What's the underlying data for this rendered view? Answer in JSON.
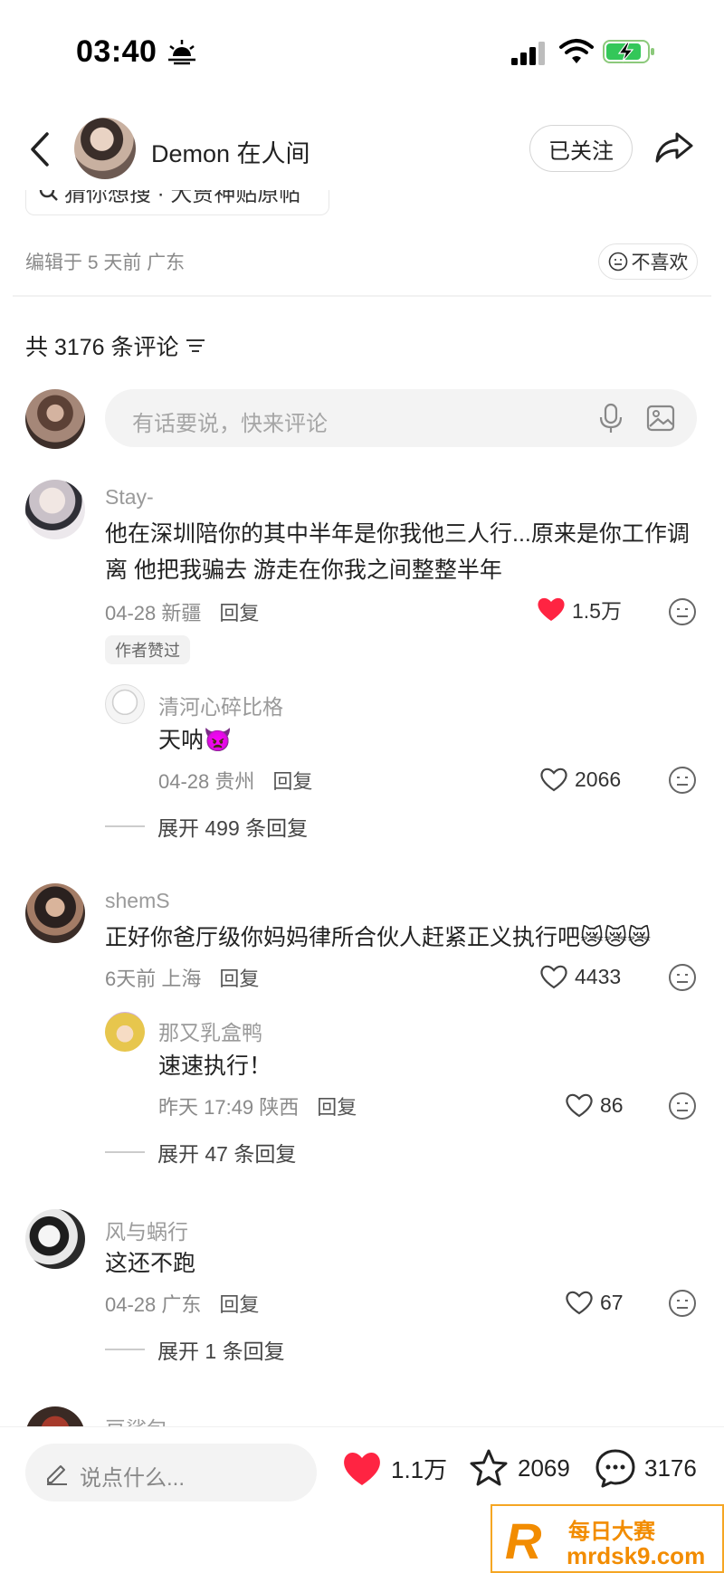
{
  "status": {
    "time": "03:40"
  },
  "header": {
    "author": "Demon 在人间",
    "follow": "已关注"
  },
  "topic": {
    "text": "猜你想搜 · 大贾神贴原帖"
  },
  "meta": {
    "edit_info": "编辑于 5 天前 广东",
    "dislike": "不喜欢"
  },
  "comments_header": {
    "count": "共 3176 条评论"
  },
  "input": {
    "placeholder": "有话要说，快来评论"
  },
  "comments": [
    {
      "name": "Stay-",
      "text": "他在深圳陪你的其中半年是你我他三人行...原来是你工作调离 他把我骗去 游走在你我之间整整半年",
      "meta": "04-28 新疆",
      "reply": "回复",
      "likes": "1.5万",
      "badge": "作者赞过",
      "sub": {
        "name": "清河心碎比格",
        "text": "天呐👿",
        "meta": "04-28 贵州",
        "reply": "回复",
        "likes": "2066"
      },
      "expand": "展开 499 条回复"
    },
    {
      "name": "shemS",
      "text": "正好你爸厅级你妈妈律所合伙人赶紧正义执行吧😿😿😿",
      "meta": "6天前 上海",
      "reply": "回复",
      "likes": "4433",
      "sub": {
        "name": "那又乳盒鸭",
        "text": "速速执行！",
        "meta": "昨天 17:49 陕西",
        "reply": "回复",
        "likes": "86"
      },
      "expand": "展开 47 条回复"
    },
    {
      "name": "风与蜗行",
      "text": "这还不跑",
      "meta": "04-28 广东",
      "reply": "回复",
      "likes": "67",
      "expand": "展开 1 条回复"
    },
    {
      "name": "豆鲨包"
    }
  ],
  "bottom": {
    "placeholder": "说点什么...",
    "likes": "1.1万",
    "collects": "2069",
    "comments": "3176"
  },
  "watermark": {
    "title": "每日大赛",
    "url": "mrdsk9.com"
  },
  "colors": {
    "like_red": "#ff2442",
    "text": "#222222",
    "muted": "#9a9a9a",
    "watermark": "#f28c00"
  },
  "icons": [
    "sun-horizon-icon",
    "signal-icon",
    "wifi-icon",
    "battery-charging-icon",
    "back-icon",
    "share-icon",
    "search-icon",
    "meh-face-icon",
    "sort-icon",
    "mic-icon",
    "image-icon",
    "heart-icon",
    "star-icon",
    "chat-icon",
    "pen-icon"
  ]
}
